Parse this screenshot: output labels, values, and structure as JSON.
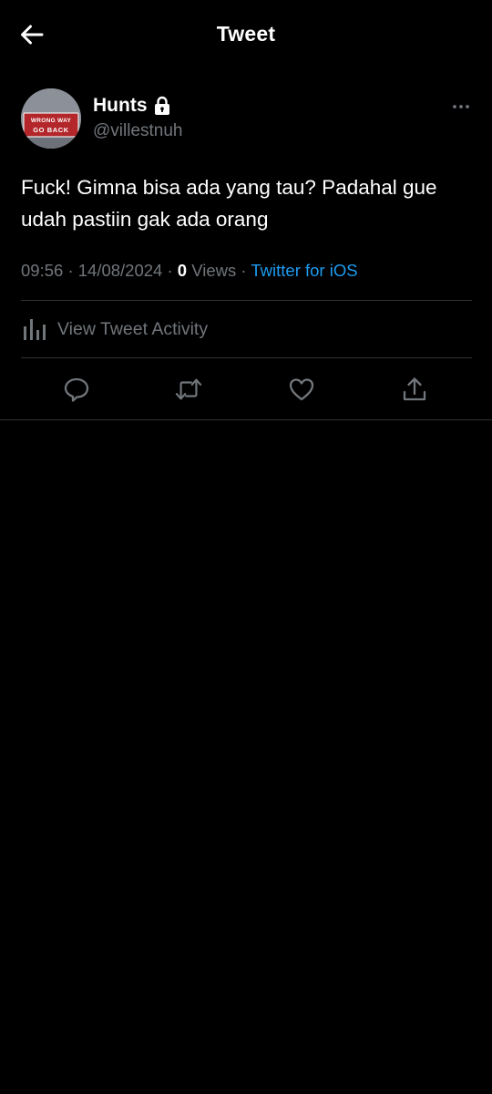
{
  "header": {
    "title": "Tweet",
    "back_icon": "arrow-left-icon"
  },
  "author": {
    "display_name": "Hunts",
    "handle": "@villestnuh",
    "protected_icon": "lock-icon",
    "avatar_sign_text": [
      "WRONG WAY",
      "GO BACK"
    ],
    "more_icon": "more-horizontal-icon"
  },
  "tweet": {
    "text": "Fuck! Gimna bisa ada yang tau? Padahal gue udah pastiin gak ada orang",
    "time": "09:56",
    "date": "14/08/2024",
    "separator": "·",
    "views_count": "0",
    "views_label": "Views",
    "source": "Twitter for iOS"
  },
  "activity": {
    "label": "View Tweet Activity",
    "icon": "bar-chart-icon"
  },
  "actions": [
    {
      "name": "reply",
      "icon": "reply-icon"
    },
    {
      "name": "retweet",
      "icon": "retweet-icon"
    },
    {
      "name": "like",
      "icon": "heart-icon"
    },
    {
      "name": "share",
      "icon": "share-icon"
    }
  ],
  "colors": {
    "background": "#000000",
    "text_primary": "#ffffff",
    "text_secondary": "#71767b",
    "accent": "#1d9bf0",
    "divider": "#2f3336",
    "avatar_sign": "#b3262a"
  }
}
